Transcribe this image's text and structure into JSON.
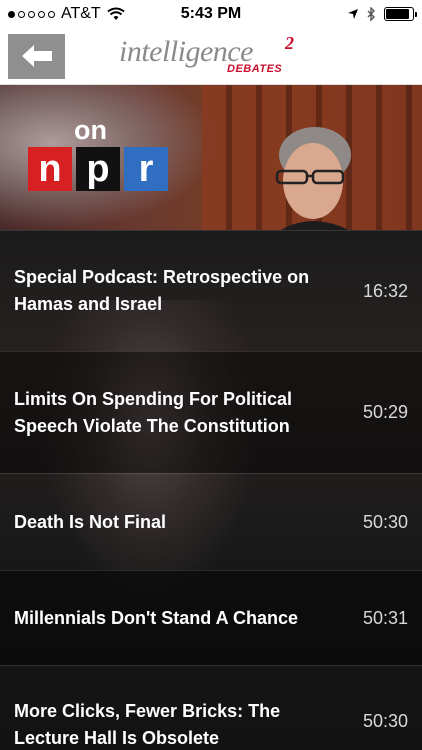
{
  "status_bar": {
    "carrier": "AT&T",
    "time": "5:43 PM",
    "signal_bars": 1,
    "battery_level": 0.9
  },
  "header": {
    "logo_main": "intelligence",
    "logo_sup": "2",
    "logo_sub": "DEBATES",
    "back_icon": "back-arrow-icon"
  },
  "banner": {
    "on_text": "on",
    "npr_letters": [
      "n",
      "p",
      "r"
    ],
    "npr_colors": [
      "#d62021",
      "#111111",
      "#2f6ec1"
    ]
  },
  "episodes": [
    {
      "title": "Special Podcast: Retrospective on Hamas and Israel",
      "duration": "16:32"
    },
    {
      "title": "Limits On Spending For Political Speech Violate The Constitution",
      "duration": "50:29"
    },
    {
      "title": "Death Is Not Final",
      "duration": "50:30"
    },
    {
      "title": "Millennials Don't Stand A Chance",
      "duration": "50:31"
    },
    {
      "title": "More Clicks, Fewer Bricks: The Lecture Hall Is Obsolete",
      "duration": "50:30"
    }
  ]
}
